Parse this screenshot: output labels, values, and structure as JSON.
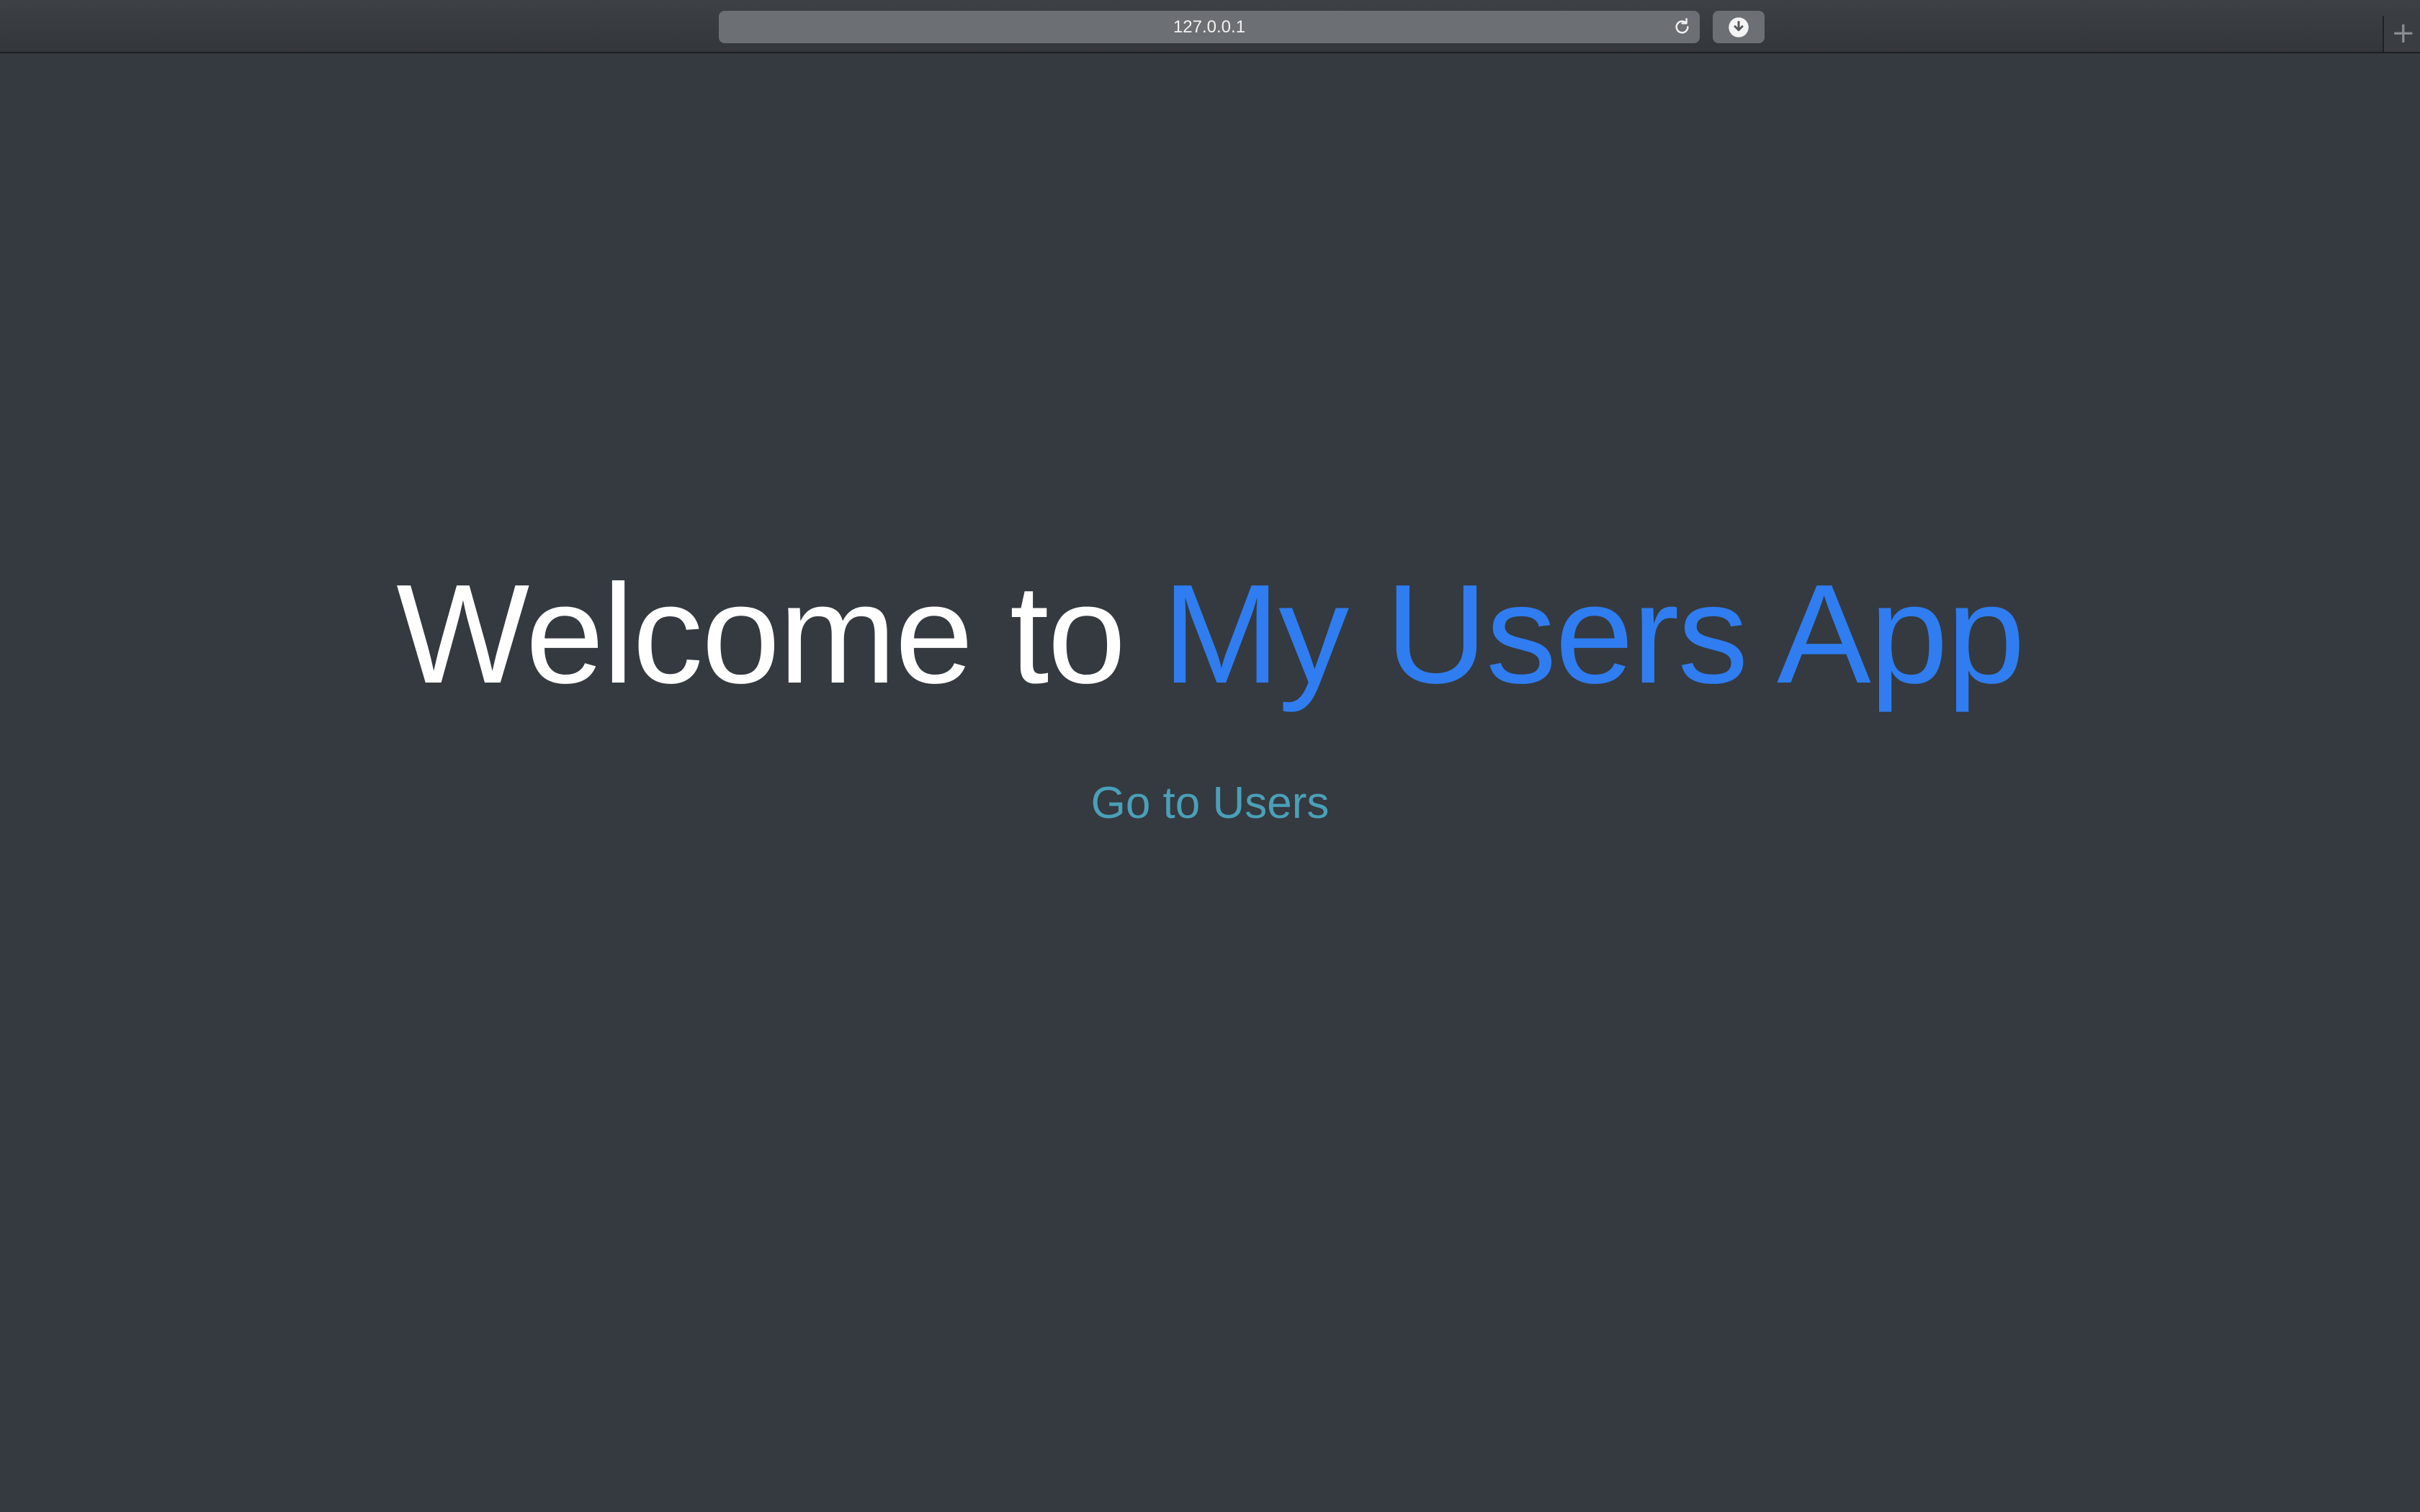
{
  "browser": {
    "address": "127.0.0.1",
    "reload_icon": "reload-icon",
    "download_icon": "download-icon",
    "new_tab_label": "+"
  },
  "main": {
    "title_prefix": "Welcome to ",
    "title_accent": "My Users App",
    "link_label": "Go to Users"
  },
  "colors": {
    "background": "#343a40",
    "accent": "#2f7df0",
    "link": "#4aa0b8"
  }
}
